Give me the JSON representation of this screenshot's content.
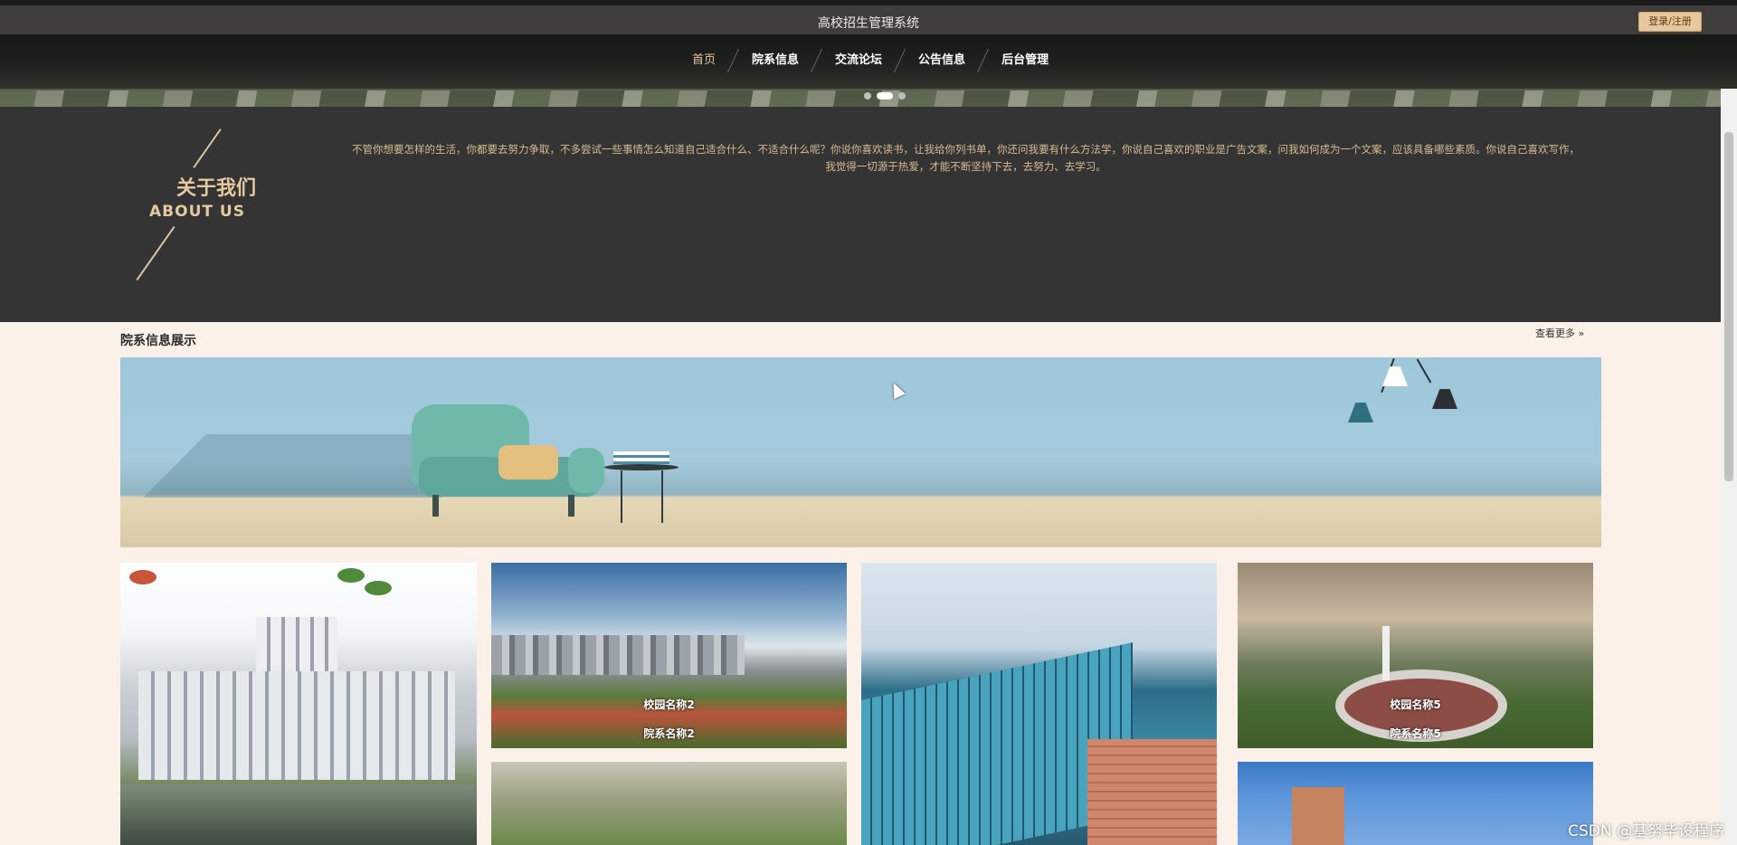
{
  "header": {
    "site_title": "高校招生管理系统",
    "login_label": "登录/注册"
  },
  "nav": {
    "items": [
      {
        "label": "首页",
        "active": true
      },
      {
        "label": "院系信息",
        "active": false
      },
      {
        "label": "交流论坛",
        "active": false
      },
      {
        "label": "公告信息",
        "active": false
      },
      {
        "label": "后台管理",
        "active": false
      }
    ],
    "carousel_active": 2
  },
  "about": {
    "title_cn": "关于我们",
    "title_en": "ABOUT US",
    "text": "不管你想要怎样的生活，你都要去努力争取，不多尝试一些事情怎么知道自己适合什么、不适合什么呢？你说你喜欢读书，让我给你列书单，你还问我要有什么方法学，你说自己喜欢的职业是广告文案，问我如何成为一个文案，应该具备哪些素质。你说自己喜欢写作，我觉得一切源于热爱，才能不断坚持下去，去努力、去学习。"
  },
  "departments": {
    "section_title": "院系信息展示",
    "more_label": "查看更多 »",
    "cards": [
      {
        "school": "校园名称2",
        "dept": "院系名称2"
      },
      {
        "school": "校园名称5",
        "dept": "院系名称5"
      }
    ]
  },
  "watermark": "CSDN @基努毕设程序",
  "colors": {
    "accent": "#e8c79d",
    "topbar": "#3f3e3c",
    "about_bg": "#343434",
    "page_bg": "#fbf1e8"
  }
}
